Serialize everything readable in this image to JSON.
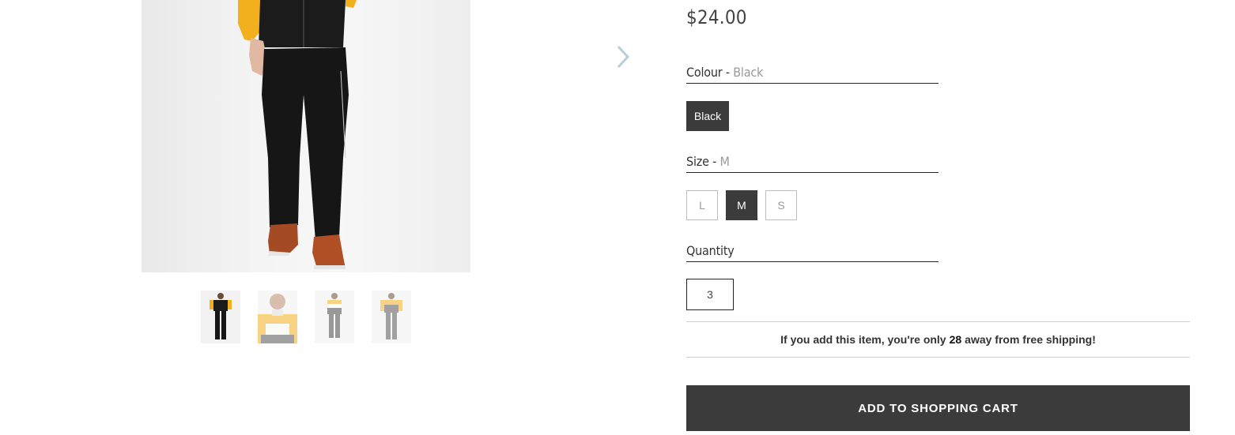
{
  "product": {
    "price": "$24.00"
  },
  "options": {
    "colour": {
      "label": "Colour - ",
      "selected": "Black",
      "swatches": [
        "Black"
      ]
    },
    "size": {
      "label": "Size - ",
      "selected": "M",
      "values": [
        "L",
        "M",
        "S"
      ]
    },
    "quantity": {
      "label": "Quantity",
      "value": "3"
    }
  },
  "shipping_note": {
    "before": "If you add this item, you're only",
    "amount": "28",
    "after": "away from free shipping!"
  },
  "cart_button": {
    "label": "ADD TO SHOPPING CART"
  },
  "icons": {
    "next": "chevron-right-icon"
  },
  "colors": {
    "dark": "#3b3b3b",
    "arrow": "#b7cfd8",
    "jacket_yellow": "#f2b01e"
  }
}
